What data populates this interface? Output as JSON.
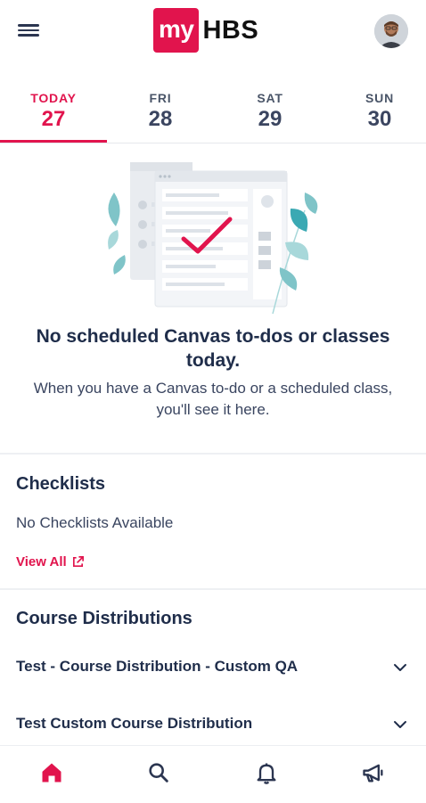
{
  "header": {
    "logo_my": "my",
    "logo_hbs": "HBS",
    "menu_icon": "hamburger-menu-icon",
    "avatar": "user-avatar"
  },
  "days": [
    {
      "name": "TODAY",
      "num": "27",
      "active": true
    },
    {
      "name": "FRI",
      "num": "28",
      "active": false
    },
    {
      "name": "SAT",
      "num": "29",
      "active": false
    },
    {
      "name": "SUN",
      "num": "30",
      "active": false
    }
  ],
  "empty_state": {
    "title": "No scheduled Canvas to-dos or classes today.",
    "subtitle": "When you have a Canvas to-do or a scheduled class, you'll see it here."
  },
  "checklists": {
    "title": "Checklists",
    "empty": "No Checklists Available",
    "view_all": "View All"
  },
  "course_distributions": {
    "title": "Course Distributions",
    "items": [
      {
        "label": "Test - Course Distribution - Custom QA"
      },
      {
        "label": "Test Custom Course Distribution"
      }
    ]
  },
  "bottom_nav": {
    "items": [
      "home-icon",
      "search-icon",
      "bell-icon",
      "megaphone-icon"
    ],
    "active": "home-icon"
  },
  "colors": {
    "accent": "#e1144d",
    "text": "#1f2d4a",
    "illustration_teal": "#3aa9b3"
  }
}
